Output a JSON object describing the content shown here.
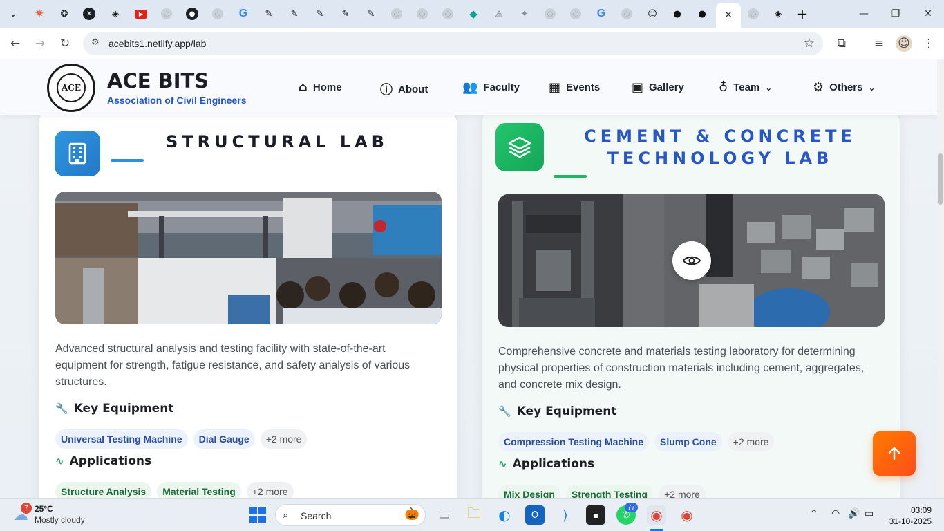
{
  "browser": {
    "url": "acebits1.netlify.app/lab",
    "active_tab_close": "✕",
    "new_tab": "+"
  },
  "site": {
    "brand_name": "ACE BITS",
    "brand_subtitle": "Association of Civil Engineers",
    "logo_text": "ACE",
    "nav": {
      "home": "Home",
      "about": "About",
      "faculty": "Faculty",
      "events": "Events",
      "gallery": "Gallery",
      "team": "Team",
      "others": "Others"
    }
  },
  "labs": [
    {
      "title": "STRUCTURAL LAB",
      "description": "Advanced structural analysis and testing facility with state-of-the-art equipment for strength, fatigue resistance, and safety analysis of various structures.",
      "equipment_heading": "Key Equipment",
      "equipment": [
        "Universal Testing Machine",
        "Dial Gauge",
        "+2 more"
      ],
      "applications_heading": "Applications",
      "applications": [
        "Structure Analysis",
        "Material Testing",
        "+2 more"
      ]
    },
    {
      "title_line1": "CEMENT & CONCRETE",
      "title_line2": "TECHNOLOGY LAB",
      "description": "Comprehensive concrete and materials testing laboratory for determining physical properties of construction materials including cement, aggregates, and concrete mix design.",
      "equipment_heading": "Key Equipment",
      "equipment": [
        "Compression Testing Machine",
        "Slump Cone",
        "+2 more"
      ],
      "applications_heading": "Applications",
      "applications": [
        "Mix Design",
        "Strength Testing",
        "+2 more"
      ]
    }
  ],
  "taskbar": {
    "weather_badge": "7",
    "temperature": "25°C",
    "condition": "Mostly cloudy",
    "search_label": "Search",
    "whatsapp_badge": "77",
    "time": "03:09",
    "date": "31-10-2025"
  },
  "colors": {
    "accent_blue": "#2757c6",
    "structural_badge": "#2d8fd9",
    "cement_badge": "#1fb866",
    "scroll_top": "#ff6a10"
  }
}
